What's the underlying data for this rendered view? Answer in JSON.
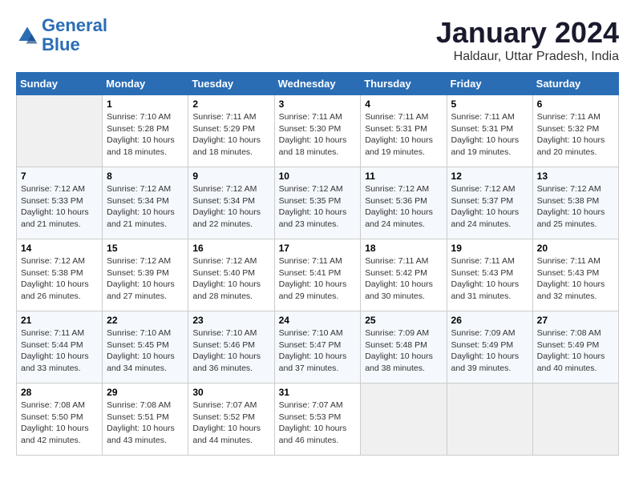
{
  "logo": {
    "line1": "General",
    "line2": "Blue"
  },
  "title": "January 2024",
  "subtitle": "Haldaur, Uttar Pradesh, India",
  "days_of_week": [
    "Sunday",
    "Monday",
    "Tuesday",
    "Wednesday",
    "Thursday",
    "Friday",
    "Saturday"
  ],
  "weeks": [
    [
      {
        "day": "",
        "info": ""
      },
      {
        "day": "1",
        "info": "Sunrise: 7:10 AM\nSunset: 5:28 PM\nDaylight: 10 hours\nand 18 minutes."
      },
      {
        "day": "2",
        "info": "Sunrise: 7:11 AM\nSunset: 5:29 PM\nDaylight: 10 hours\nand 18 minutes."
      },
      {
        "day": "3",
        "info": "Sunrise: 7:11 AM\nSunset: 5:30 PM\nDaylight: 10 hours\nand 18 minutes."
      },
      {
        "day": "4",
        "info": "Sunrise: 7:11 AM\nSunset: 5:31 PM\nDaylight: 10 hours\nand 19 minutes."
      },
      {
        "day": "5",
        "info": "Sunrise: 7:11 AM\nSunset: 5:31 PM\nDaylight: 10 hours\nand 19 minutes."
      },
      {
        "day": "6",
        "info": "Sunrise: 7:11 AM\nSunset: 5:32 PM\nDaylight: 10 hours\nand 20 minutes."
      }
    ],
    [
      {
        "day": "7",
        "info": "Sunrise: 7:12 AM\nSunset: 5:33 PM\nDaylight: 10 hours\nand 21 minutes."
      },
      {
        "day": "8",
        "info": "Sunrise: 7:12 AM\nSunset: 5:34 PM\nDaylight: 10 hours\nand 21 minutes."
      },
      {
        "day": "9",
        "info": "Sunrise: 7:12 AM\nSunset: 5:34 PM\nDaylight: 10 hours\nand 22 minutes."
      },
      {
        "day": "10",
        "info": "Sunrise: 7:12 AM\nSunset: 5:35 PM\nDaylight: 10 hours\nand 23 minutes."
      },
      {
        "day": "11",
        "info": "Sunrise: 7:12 AM\nSunset: 5:36 PM\nDaylight: 10 hours\nand 24 minutes."
      },
      {
        "day": "12",
        "info": "Sunrise: 7:12 AM\nSunset: 5:37 PM\nDaylight: 10 hours\nand 24 minutes."
      },
      {
        "day": "13",
        "info": "Sunrise: 7:12 AM\nSunset: 5:38 PM\nDaylight: 10 hours\nand 25 minutes."
      }
    ],
    [
      {
        "day": "14",
        "info": "Sunrise: 7:12 AM\nSunset: 5:38 PM\nDaylight: 10 hours\nand 26 minutes."
      },
      {
        "day": "15",
        "info": "Sunrise: 7:12 AM\nSunset: 5:39 PM\nDaylight: 10 hours\nand 27 minutes."
      },
      {
        "day": "16",
        "info": "Sunrise: 7:12 AM\nSunset: 5:40 PM\nDaylight: 10 hours\nand 28 minutes."
      },
      {
        "day": "17",
        "info": "Sunrise: 7:11 AM\nSunset: 5:41 PM\nDaylight: 10 hours\nand 29 minutes."
      },
      {
        "day": "18",
        "info": "Sunrise: 7:11 AM\nSunset: 5:42 PM\nDaylight: 10 hours\nand 30 minutes."
      },
      {
        "day": "19",
        "info": "Sunrise: 7:11 AM\nSunset: 5:43 PM\nDaylight: 10 hours\nand 31 minutes."
      },
      {
        "day": "20",
        "info": "Sunrise: 7:11 AM\nSunset: 5:43 PM\nDaylight: 10 hours\nand 32 minutes."
      }
    ],
    [
      {
        "day": "21",
        "info": "Sunrise: 7:11 AM\nSunset: 5:44 PM\nDaylight: 10 hours\nand 33 minutes."
      },
      {
        "day": "22",
        "info": "Sunrise: 7:10 AM\nSunset: 5:45 PM\nDaylight: 10 hours\nand 34 minutes."
      },
      {
        "day": "23",
        "info": "Sunrise: 7:10 AM\nSunset: 5:46 PM\nDaylight: 10 hours\nand 36 minutes."
      },
      {
        "day": "24",
        "info": "Sunrise: 7:10 AM\nSunset: 5:47 PM\nDaylight: 10 hours\nand 37 minutes."
      },
      {
        "day": "25",
        "info": "Sunrise: 7:09 AM\nSunset: 5:48 PM\nDaylight: 10 hours\nand 38 minutes."
      },
      {
        "day": "26",
        "info": "Sunrise: 7:09 AM\nSunset: 5:49 PM\nDaylight: 10 hours\nand 39 minutes."
      },
      {
        "day": "27",
        "info": "Sunrise: 7:08 AM\nSunset: 5:49 PM\nDaylight: 10 hours\nand 40 minutes."
      }
    ],
    [
      {
        "day": "28",
        "info": "Sunrise: 7:08 AM\nSunset: 5:50 PM\nDaylight: 10 hours\nand 42 minutes."
      },
      {
        "day": "29",
        "info": "Sunrise: 7:08 AM\nSunset: 5:51 PM\nDaylight: 10 hours\nand 43 minutes."
      },
      {
        "day": "30",
        "info": "Sunrise: 7:07 AM\nSunset: 5:52 PM\nDaylight: 10 hours\nand 44 minutes."
      },
      {
        "day": "31",
        "info": "Sunrise: 7:07 AM\nSunset: 5:53 PM\nDaylight: 10 hours\nand 46 minutes."
      },
      {
        "day": "",
        "info": ""
      },
      {
        "day": "",
        "info": ""
      },
      {
        "day": "",
        "info": ""
      }
    ]
  ]
}
